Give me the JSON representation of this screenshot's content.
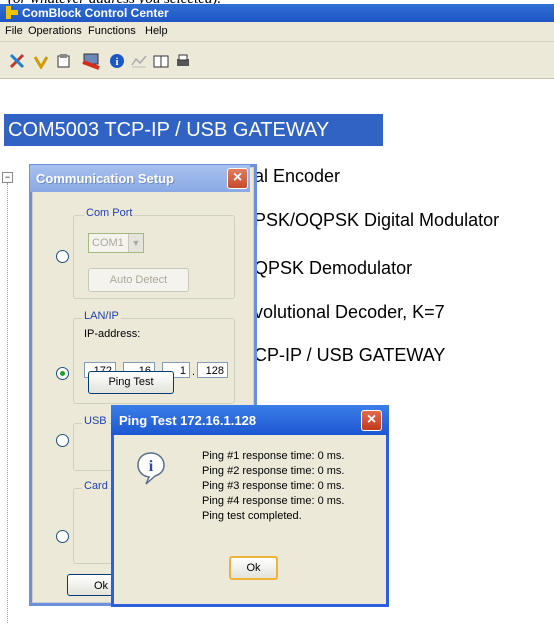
{
  "caption_partial": "(or whatever address you selected).",
  "app": {
    "title": "ComBlock Control Center",
    "menu": [
      "File",
      "Operations",
      "Functions",
      "Help"
    ],
    "toolbar_icons": [
      "tools-icon",
      "wand-icon",
      "properties-icon",
      "monitor-icon",
      "info-icon",
      "chart-icon",
      "book-icon",
      "printer-icon"
    ]
  },
  "tree": {
    "selected": "COM5003 TCP-IP / USB GATEWAY",
    "items": [
      "al Encoder",
      "PSK/OQPSK Digital Modulator",
      "QPSK Demodulator",
      "volutional Decoder, K=7",
      "CP-IP / USB GATEWAY"
    ]
  },
  "comm_dialog": {
    "title": "Communication Setup",
    "com_port": {
      "label": "Com Port",
      "value": "COM1",
      "auto_detect": "Auto Detect"
    },
    "lan": {
      "label": "LAN/IP",
      "ip_label": "IP-address:",
      "ip": [
        "172",
        "16",
        "1",
        "128"
      ],
      "ping_button": "Ping Test"
    },
    "usb_label": "USB",
    "card_label": "Card",
    "ok_label": "Ok"
  },
  "ping_dialog": {
    "title": "Ping Test 172.16.1.128",
    "lines": [
      "Ping #1 response time: 0 ms.",
      "Ping #2 response time: 0 ms.",
      "Ping #3 response time: 0 ms.",
      "Ping #4 response time: 0 ms.",
      "Ping test completed."
    ],
    "ok_label": "Ok"
  },
  "colors": {
    "selection": "#3163c5",
    "titlebar": "#1f56c4",
    "dialog_bg": "#ece9d8"
  }
}
